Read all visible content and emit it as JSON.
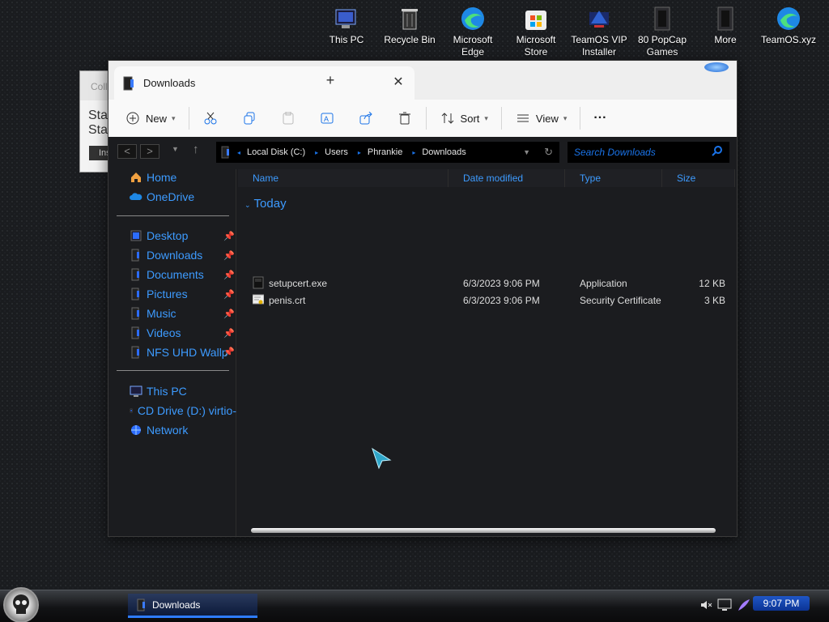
{
  "desktop": {
    "icons": [
      {
        "label": "This PC",
        "icon": "this-pc-icon"
      },
      {
        "label": "Recycle Bin",
        "icon": "recycle-bin-icon"
      },
      {
        "label": "Microsoft\nEdge",
        "icon": "edge-icon"
      },
      {
        "label": "Microsoft\nStore",
        "icon": "store-icon"
      },
      {
        "label": "TeamOS VIP\nInstaller",
        "icon": "installer-icon"
      },
      {
        "label": "80 PopCap\nGames",
        "icon": "games-folder-icon"
      },
      {
        "label": "More",
        "icon": "more-folder-icon"
      },
      {
        "label": "TeamOS.xyz",
        "icon": "edge-icon"
      }
    ]
  },
  "background_window": {
    "title": "Colla",
    "text": "Sta\nSta",
    "button": "Ins"
  },
  "explorer": {
    "tab_title": "Downloads",
    "toolbar": {
      "new_label": "New",
      "sort_label": "Sort",
      "view_label": "View",
      "more_label": "···"
    },
    "address": {
      "segments": [
        "Local Disk (C:)",
        "Users",
        "Phrankie",
        "Downloads"
      ]
    },
    "search_placeholder": "Search Downloads",
    "sidebar": {
      "home": "Home",
      "onedrive": "OneDrive",
      "quick": [
        {
          "label": "Desktop",
          "pinned": true
        },
        {
          "label": "Downloads",
          "pinned": true
        },
        {
          "label": "Documents",
          "pinned": true
        },
        {
          "label": "Pictures",
          "pinned": true
        },
        {
          "label": "Music",
          "pinned": true
        },
        {
          "label": "Videos",
          "pinned": true
        },
        {
          "label": "NFS UHD Wallp",
          "pinned": true
        }
      ],
      "this_pc": "This PC",
      "cd_drive": "CD Drive (D:) virtio-",
      "network": "Network"
    },
    "columns": {
      "name": "Name",
      "date": "Date modified",
      "type": "Type",
      "size": "Size"
    },
    "group_label": "Today",
    "files": [
      {
        "name": "setupcert.exe",
        "date": "6/3/2023 9:06 PM",
        "type": "Application",
        "size": "12 KB",
        "icon": "application-icon"
      },
      {
        "name": "penis.crt",
        "date": "6/3/2023 9:06 PM",
        "type": "Security Certificate",
        "size": "3 KB",
        "icon": "certificate-icon"
      }
    ]
  },
  "taskbar": {
    "task_label": "Downloads",
    "clock": "9:07 PM"
  },
  "colors": {
    "accent_blue": "#3d9bff",
    "taskbar_active": "#2e7cff"
  }
}
